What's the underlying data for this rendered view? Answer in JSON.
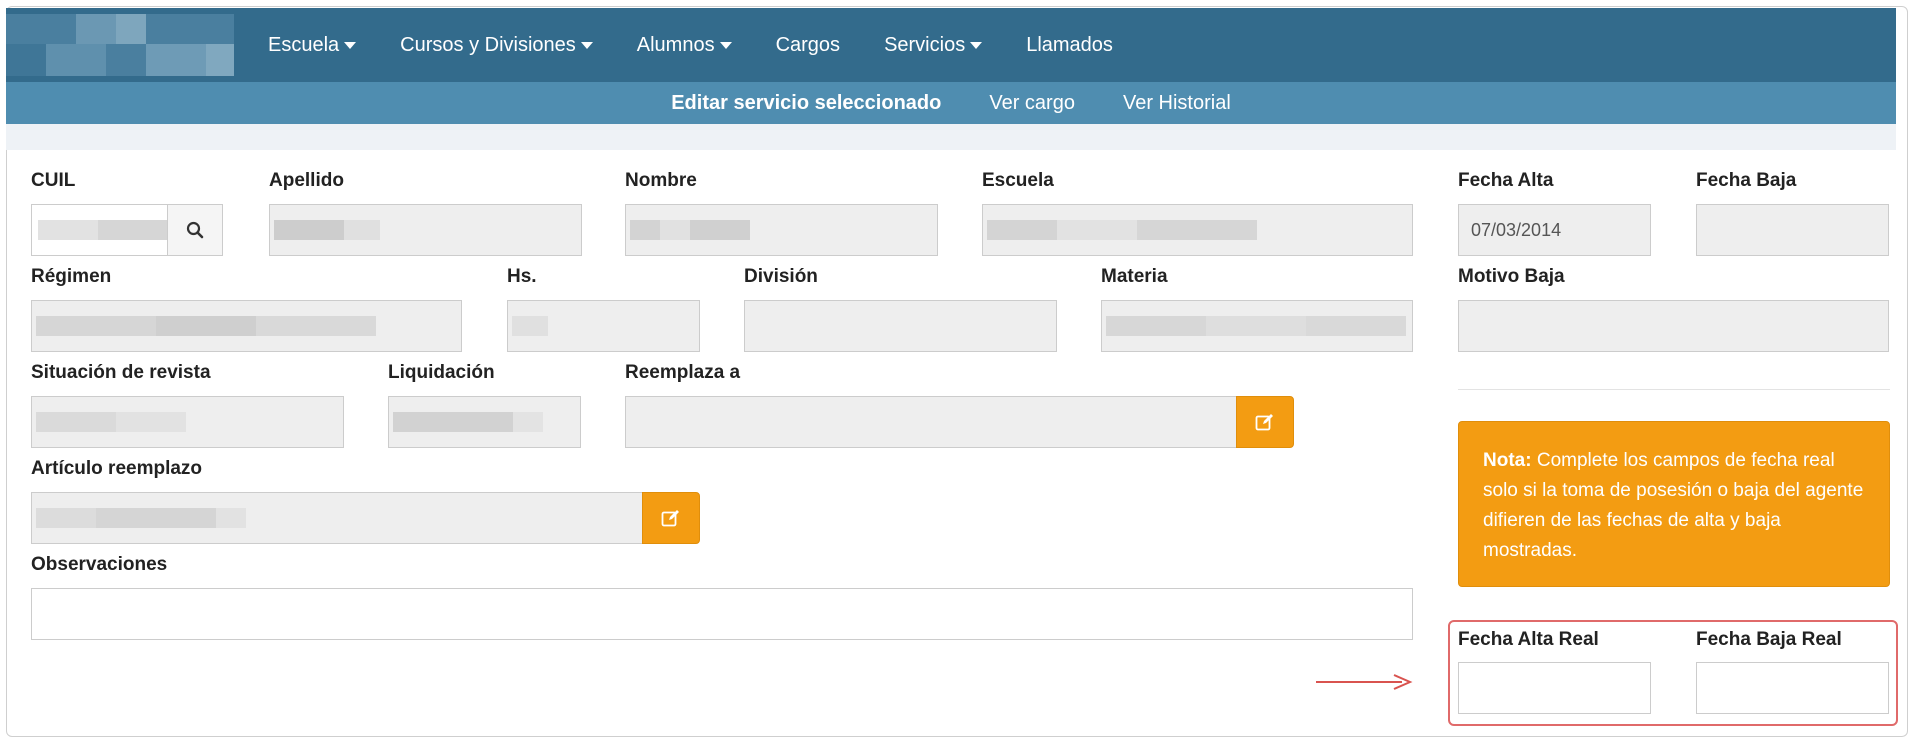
{
  "nav": {
    "items": [
      {
        "label": "Escuela",
        "dropdown": true
      },
      {
        "label": "Cursos y Divisiones",
        "dropdown": true
      },
      {
        "label": "Alumnos",
        "dropdown": true
      },
      {
        "label": "Cargos",
        "dropdown": false
      },
      {
        "label": "Servicios",
        "dropdown": true
      },
      {
        "label": "Llamados",
        "dropdown": false
      }
    ]
  },
  "subnav": {
    "items": [
      "Editar servicio seleccionado",
      "Ver cargo",
      "Ver Historial"
    ]
  },
  "form": {
    "labels": {
      "cuil": "CUIL",
      "apellido": "Apellido",
      "nombre": "Nombre",
      "escuela": "Escuela",
      "fecha_alta": "Fecha Alta",
      "fecha_baja": "Fecha Baja",
      "regimen": "Régimen",
      "hs": "Hs.",
      "division": "División",
      "materia": "Materia",
      "motivo_baja": "Motivo Baja",
      "situacion": "Situación de revista",
      "liquidacion": "Liquidación",
      "reemplaza": "Reemplaza a",
      "articulo": "Artículo reemplazo",
      "observaciones": "Observaciones",
      "fecha_alta_real": "Fecha Alta Real",
      "fecha_baja_real": "Fecha Baja Real"
    },
    "values": {
      "fecha_alta": "07/03/2014"
    }
  },
  "note": {
    "title": "Nota:",
    "text": "Complete los campos de fecha real solo si la toma de posesión o baja del agente difieren de las fechas de alta y baja mostradas."
  },
  "colors": {
    "navbar": "#336b8c",
    "subnav": "#4f8db0",
    "accent": "#f39c12",
    "highlight_border": "#e06a6a"
  },
  "icons": {
    "search": "search-icon",
    "edit": "edit-icon"
  }
}
